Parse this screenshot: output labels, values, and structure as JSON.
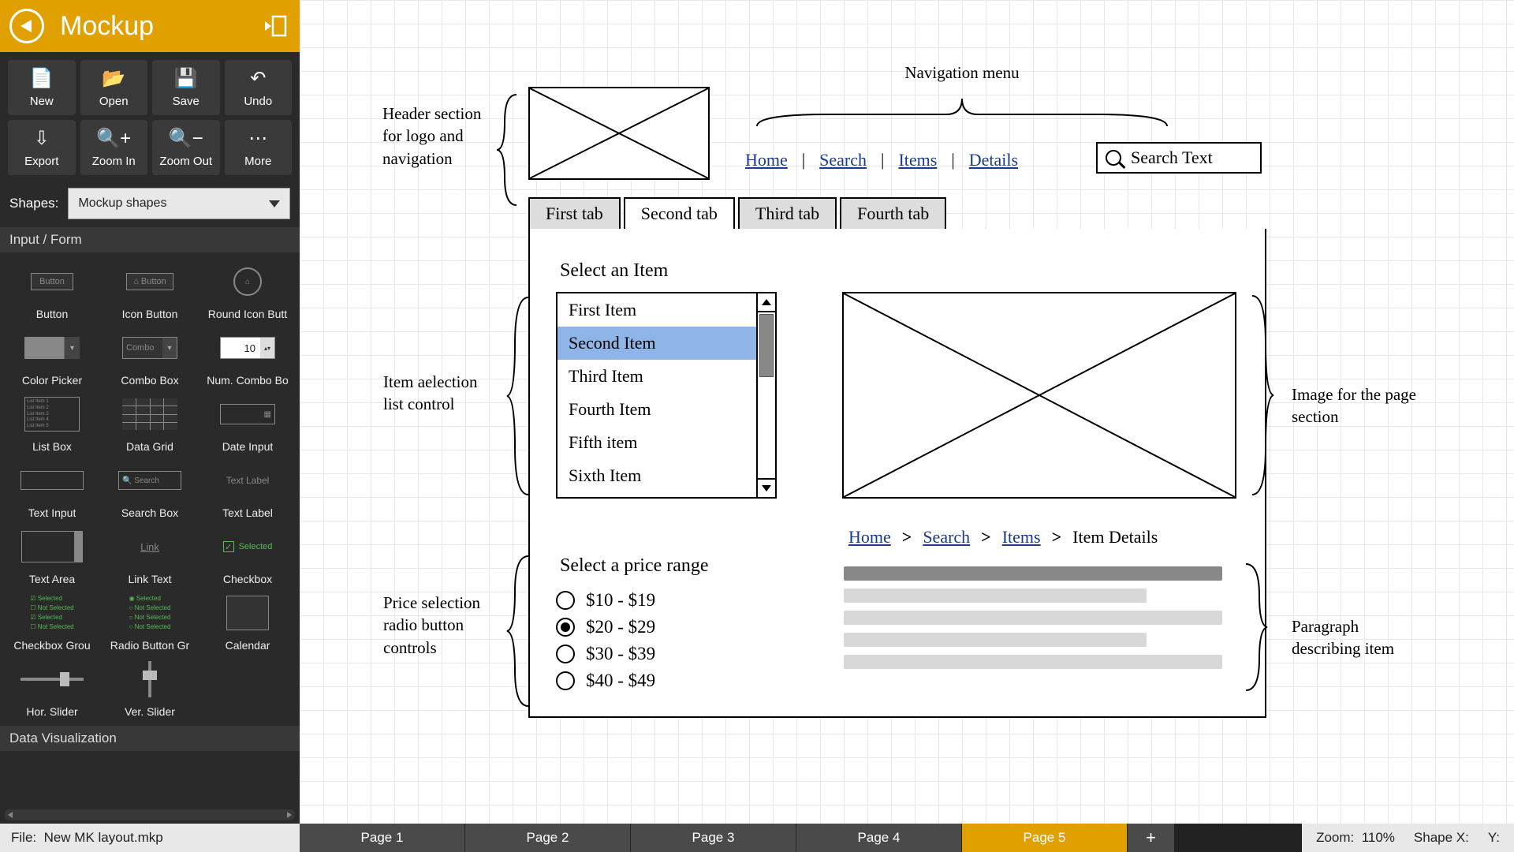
{
  "app": {
    "title": "Mockup"
  },
  "toolbar": [
    {
      "id": "new",
      "label": "New",
      "glyph": "📄"
    },
    {
      "id": "open",
      "label": "Open",
      "glyph": "📂"
    },
    {
      "id": "save",
      "label": "Save",
      "glyph": "💾"
    },
    {
      "id": "undo",
      "label": "Undo",
      "glyph": "↶"
    },
    {
      "id": "export",
      "label": "Export",
      "glyph": "⇩"
    },
    {
      "id": "zoom-in",
      "label": "Zoom In",
      "glyph": "🔍+"
    },
    {
      "id": "zoom-out",
      "label": "Zoom Out",
      "glyph": "🔍−"
    },
    {
      "id": "more",
      "label": "More",
      "glyph": "⋯"
    }
  ],
  "shapes": {
    "label": "Shapes:",
    "selected": "Mockup shapes",
    "section1_title": "Input / Form",
    "section2_title": "Data Visualization",
    "items": [
      "Button",
      "Icon Button",
      "Round Icon Butt",
      "Color Picker",
      "Combo Box",
      "Num. Combo Bo",
      "List Box",
      "Data Grid",
      "Date Input",
      "Text Input",
      "Search Box",
      "Text Label",
      "Text Area",
      "Link Text",
      "Checkbox",
      "Checkbox Grou",
      "Radio Button Gr",
      "Calendar",
      "Hor. Slider",
      "Ver. Slider"
    ]
  },
  "canvas": {
    "annotations": {
      "header": "Header section for logo and navigation",
      "navmenu": "Navigation menu",
      "itemlist": "Item aelection list control",
      "price": "Price selection radio button controls",
      "image": "Image for the page section",
      "paragraph": "Paragraph describing item"
    },
    "nav_links": [
      "Home",
      "Search",
      "Items",
      "Details"
    ],
    "search_placeholder": "Search Text",
    "tabs": [
      "First tab",
      "Second tab",
      "Third tab",
      "Fourth tab"
    ],
    "active_tab_index": 1,
    "select_item_title": "Select an Item",
    "list_items": [
      "First Item",
      "Second Item",
      "Third Item",
      "Fourth Item",
      "Fifth item",
      "Sixth Item"
    ],
    "selected_list_index": 1,
    "breadcrumb": [
      "Home",
      "Search",
      "Items",
      "Item Details"
    ],
    "price_title": "Select a price range",
    "price_options": [
      "$10 - $19",
      "$20 - $29",
      "$30 - $39",
      "$40 - $49"
    ],
    "selected_price_index": 1
  },
  "footer": {
    "file_prefix": "File:",
    "file_name": "New MK layout.mkp",
    "pages": [
      "Page 1",
      "Page 2",
      "Page 3",
      "Page 4",
      "Page 5"
    ],
    "active_page_index": 4,
    "zoom_label": "Zoom:",
    "zoom_value": "110%",
    "shapex_label": "Shape X:",
    "y_label": "Y:"
  }
}
